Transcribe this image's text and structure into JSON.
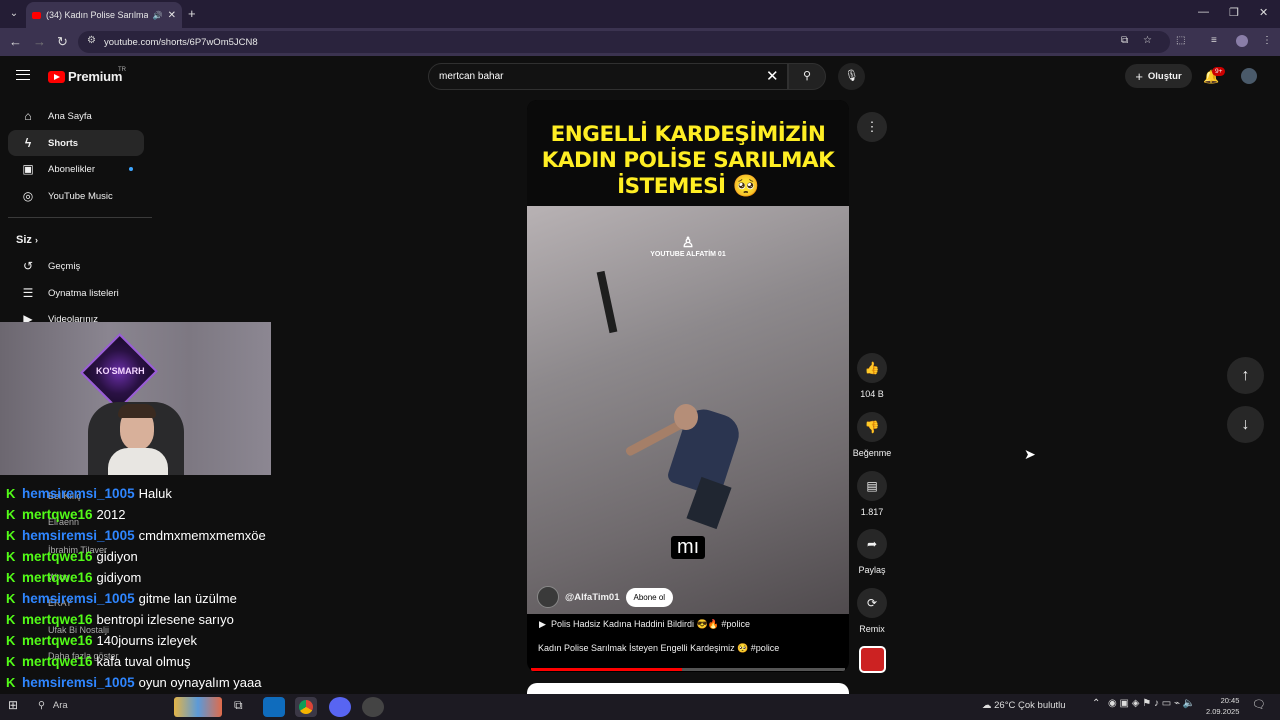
{
  "browser": {
    "tab_title": "(34) Kadın Polise Sarılmak İs",
    "url": "youtube.com/shorts/6P7wOm5JCN8"
  },
  "youtube": {
    "logo_text": "Premium",
    "region": "TR",
    "search_value": "mertcan bahar",
    "create_label": "Oluştur",
    "notif_badge": "9+"
  },
  "sidebar": {
    "items": [
      {
        "label": "Ana Sayfa",
        "icon": "home-icon"
      },
      {
        "label": "Shorts",
        "icon": "shorts-icon"
      },
      {
        "label": "Abonelikler",
        "icon": "subscriptions-icon"
      },
      {
        "label": "YouTube Music",
        "icon": "music-icon"
      }
    ],
    "section_title": "Siz",
    "you_items": [
      {
        "label": "Geçmiş",
        "icon": "history-icon"
      },
      {
        "label": "Oynatma listeleri",
        "icon": "playlist-icon"
      },
      {
        "label": "Videolarınız",
        "icon": "videos-icon"
      }
    ],
    "ghost_labels": [
      "Bel Kılıç",
      "Elraenn",
      "İbrahim Tilaver",
      "Wtcn",
      "ERAY",
      "Ufak Bi Nostalji",
      "Daha fazla göster"
    ]
  },
  "webcam": {
    "sign_text": "KO'SMARH"
  },
  "chat": [
    {
      "user": "hemsiremsi_1005",
      "message": "Haluk",
      "color": "#2f86ff"
    },
    {
      "user": "mertqwe16",
      "message": "2012",
      "color": "#53fc18"
    },
    {
      "user": "hemsiremsi_1005",
      "message": "cmdmxmemxmemxöe",
      "color": "#2f86ff"
    },
    {
      "user": "mertqwe16",
      "message": "gidiyon",
      "color": "#53fc18"
    },
    {
      "user": "mertqwe16",
      "message": "gidiyom",
      "color": "#53fc18"
    },
    {
      "user": "hemsiremsi_1005",
      "message": "gitme lan üzülme",
      "color": "#2f86ff"
    },
    {
      "user": "mertqwe16",
      "message": "bentropi izlesene sarıyo",
      "color": "#53fc18"
    },
    {
      "user": "mertqwe16",
      "message": "140journs izleyek",
      "color": "#53fc18"
    },
    {
      "user": "mertqwe16",
      "message": "kafa tuval olmuş",
      "color": "#53fc18"
    },
    {
      "user": "hemsiremsi_1005",
      "message": "oyun oynayalım yaaa",
      "color": "#2f86ff"
    }
  ],
  "short": {
    "headline": [
      "ENGELLİ KARDEŞİMİZİN",
      "KADIN POLİSE SARILMAK",
      "İSTEMESİ 🥺"
    ],
    "watermark": "YOUTUBE ALFATİM 01",
    "subtitle": "mı",
    "channel": "@AlfaTim01",
    "subscribe_label": "Abone ol",
    "song": "Polis Hadsiz Kadına Haddini Bildirdi 😎🔥 #police",
    "description": "Kadın Polise Sarılmak İsteyen Engelli Kardeşimiz 🥺 #police",
    "progress": 0.48
  },
  "actions": {
    "like_count": "104 B",
    "dislike_label": "Beğenme",
    "comment_count": "1.817",
    "share_label": "Paylaş",
    "remix_label": "Remix"
  },
  "taskbar": {
    "search_label": "Ara",
    "weather": "26°C  Çok bulutlu",
    "time": "20:45",
    "date": "2.09.2025"
  }
}
